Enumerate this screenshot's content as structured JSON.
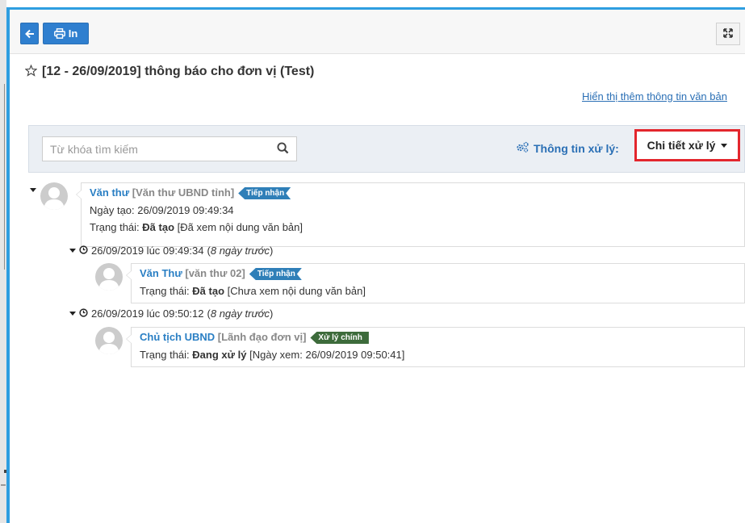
{
  "toolbar": {
    "print_label": "In"
  },
  "document": {
    "title": "[12 - 26/09/2019] thông báo cho đơn vị (Test)",
    "more_info_link": "Hiển thị thêm thông tin văn bản"
  },
  "filter": {
    "search_placeholder": "Từ khóa tìm kiếm",
    "info_label": "Thông tin xử lý:",
    "dropdown_selected": "Chi tiết xử lý"
  },
  "tree": {
    "root": {
      "name": "Văn thư",
      "role": "[Văn thư UBND tỉnh]",
      "badge": "Tiếp nhận",
      "created_label": "Ngày tạo: 26/09/2019 09:49:34",
      "status_prefix": "Trạng thái: ",
      "status_value": "Đã tạo",
      "status_note": " [Đã xem nội dung văn bản]"
    },
    "groups": [
      {
        "time": "26/09/2019 lúc 09:49:34",
        "relative": "8 ngày trước",
        "entry": {
          "name": "Văn Thư",
          "role": "[văn thư 02]",
          "badge": "Tiếp nhận",
          "status_prefix": "Trạng thái: ",
          "status_value": "Đã tạo",
          "status_note": " [Chưa xem nội dung văn bản]"
        }
      },
      {
        "time": "26/09/2019 lúc 09:50:12",
        "relative": "8 ngày trước",
        "entry": {
          "name": "Chủ tịch UBND",
          "role": "[Lãnh đạo đơn vị]",
          "badge": "Xử lý chính",
          "status_prefix": "Trạng thái: ",
          "status_value": "Đang xử lý",
          "status_note": " [Ngày xem: 26/09/2019 09:50:41]"
        }
      }
    ]
  },
  "colors": {
    "accent": "#2e9ee0",
    "button": "#2f7fcf",
    "badge_receive": "#2f7fb8",
    "badge_main": "#3d6b3b",
    "highlight_border": "#e3262d"
  }
}
